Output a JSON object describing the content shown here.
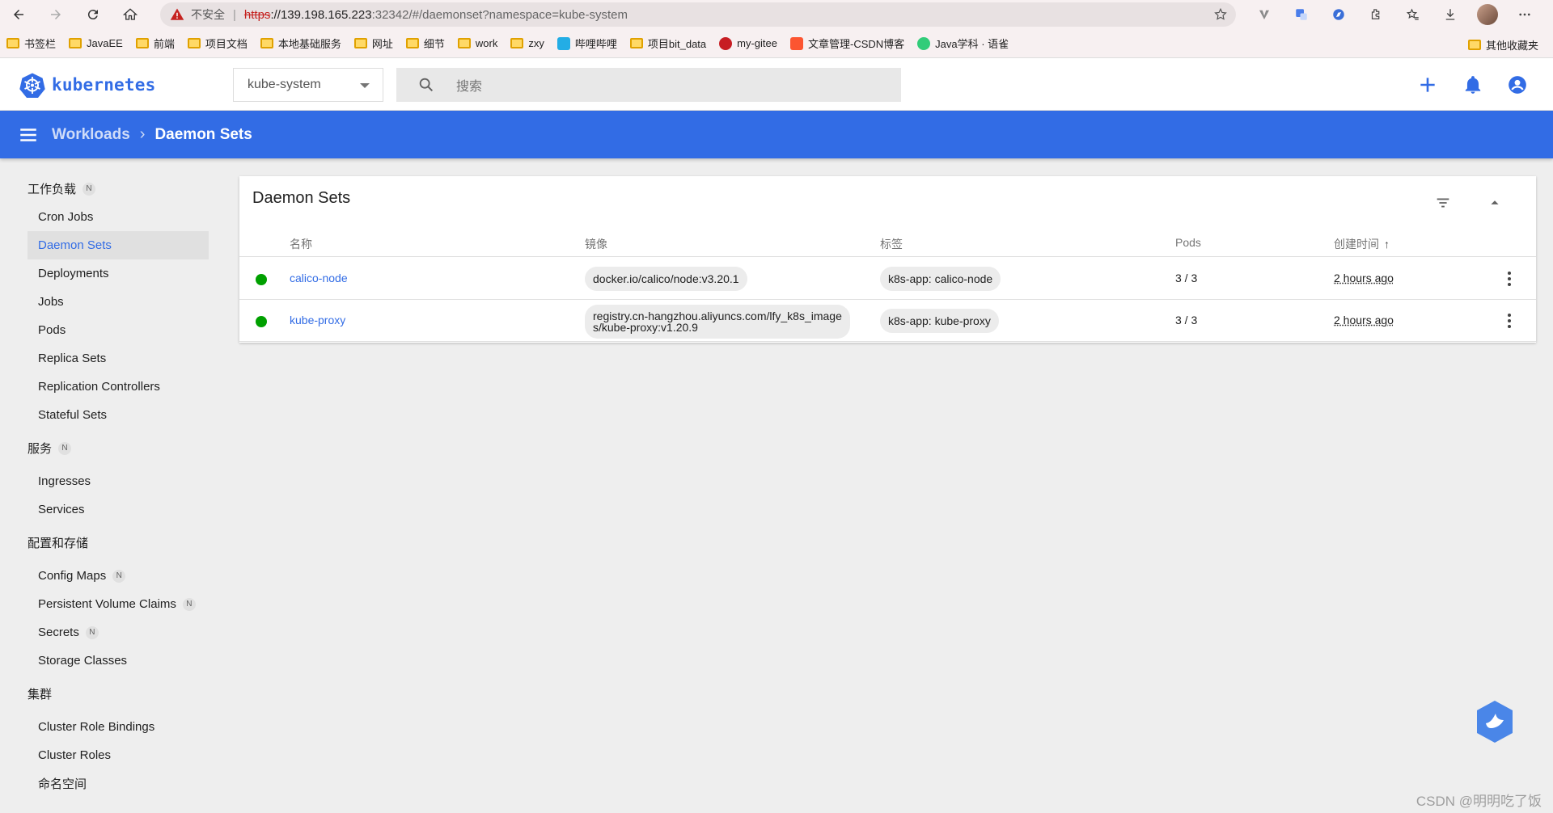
{
  "browser": {
    "not_secure": "不安全",
    "url_scheme": "https",
    "url_host": "://139.198.165.223",
    "url_rest": ":32342/#/daemonset?namespace=kube-system",
    "bookmarks": [
      "书签栏",
      "JavaEE",
      "前端",
      "项目文档",
      "本地基础服务",
      "网址",
      "细节",
      "work",
      "zxy",
      "哔哩哔哩",
      "项目bit_data",
      "my-gitee",
      "文章管理-CSDN博客",
      "Java学科 · 语雀"
    ],
    "bookmarks_right": "其他收藏夹"
  },
  "header": {
    "logo_text": "kubernetes",
    "namespace": "kube-system",
    "search_placeholder": "搜索"
  },
  "toolbar": {
    "parent": "Workloads",
    "separator": "›",
    "current": "Daemon Sets"
  },
  "sidebar": {
    "badge": "N",
    "sections": [
      {
        "title": "工作负载",
        "items": [
          "Cron Jobs",
          "Daemon Sets",
          "Deployments",
          "Jobs",
          "Pods",
          "Replica Sets",
          "Replication Controllers",
          "Stateful Sets"
        ]
      },
      {
        "title": "服务",
        "items": [
          "Ingresses",
          "Services"
        ]
      },
      {
        "title": "配置和存储",
        "items": [
          "Config Maps",
          "Persistent Volume Claims",
          "Secrets",
          "Storage Classes"
        ]
      },
      {
        "title": "集群",
        "items": [
          "Cluster Role Bindings",
          "Cluster Roles",
          "命名空间"
        ]
      }
    ]
  },
  "card": {
    "title": "Daemon Sets",
    "columns": {
      "name": "名称",
      "image": "镜像",
      "labels": "标签",
      "pods": "Pods",
      "created": "创建时间",
      "sort_arrow": "↑"
    },
    "rows": [
      {
        "name": "calico-node",
        "image_line1": "docker.io/calico/node:v3.20.1",
        "image_line2": "",
        "label": "k8s-app: calico-node",
        "pods": "3 / 3",
        "created": "2 hours ago",
        "status": "running"
      },
      {
        "name": "kube-proxy",
        "image_line1": "registry.cn-hangzhou.aliyuncs.com/lfy_k8s_image",
        "image_line2": "s/kube-proxy:v1.20.9",
        "label": "k8s-app: kube-proxy",
        "pods": "3 / 3",
        "created": "2 hours ago",
        "status": "running"
      }
    ]
  },
  "watermark": "CSDN @明明吃了饭",
  "colors": {
    "accent": "#326ce5",
    "status_ok": "#00a000",
    "background": "#eeeeee"
  },
  "icons": [
    "back-icon",
    "forward-icon",
    "reload-icon",
    "home-icon",
    "warning-icon",
    "favorite-icon",
    "search-icon",
    "add-icon",
    "notifications-icon",
    "account-icon",
    "menu-icon",
    "filter-icon",
    "collapse-icon",
    "more-vert-icon"
  ]
}
